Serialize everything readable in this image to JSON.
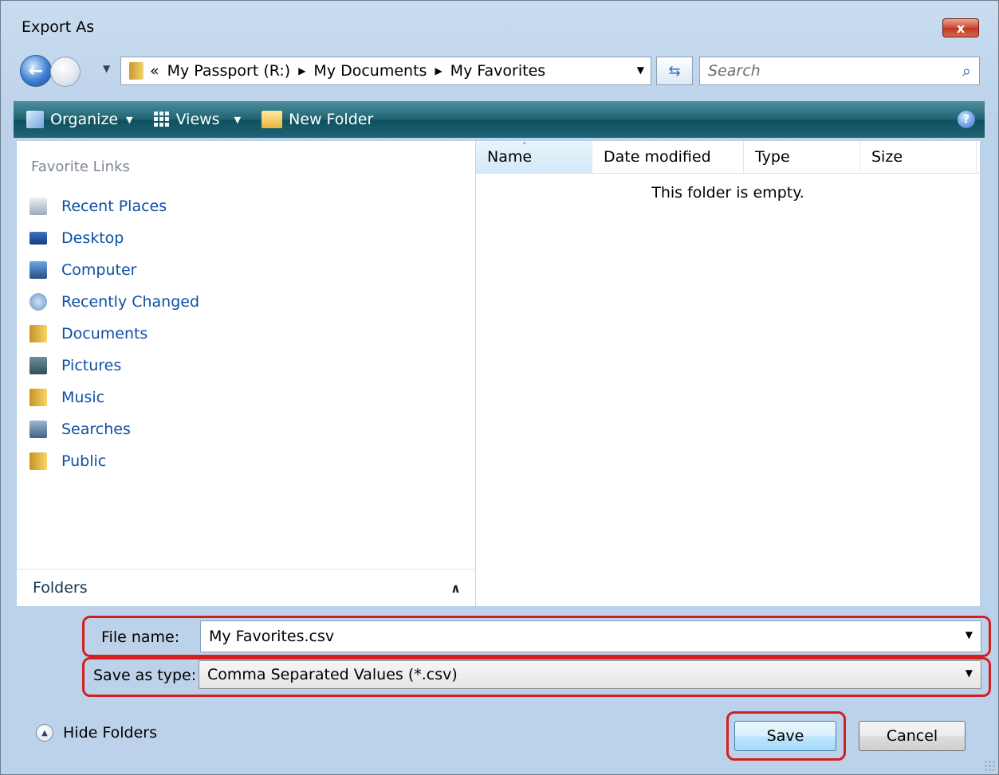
{
  "window": {
    "title": "Export As",
    "close_label": "x"
  },
  "address_bar": {
    "breadcrumbs": [
      "«",
      "My Passport (R:)",
      "My Documents",
      "My Favorites"
    ],
    "search_placeholder": "Search"
  },
  "toolbar": {
    "organize_label": "Organize",
    "views_label": "Views",
    "new_folder_label": "New Folder",
    "help_label": "?"
  },
  "nav_pane": {
    "heading": "Favorite Links",
    "items": [
      {
        "label": "Recent Places",
        "icon": "recent-places-icon"
      },
      {
        "label": "Desktop",
        "icon": "desktop-icon"
      },
      {
        "label": "Computer",
        "icon": "computer-icon"
      },
      {
        "label": "Recently Changed",
        "icon": "recently-changed-icon"
      },
      {
        "label": "Documents",
        "icon": "folder-icon"
      },
      {
        "label": "Pictures",
        "icon": "pictures-icon"
      },
      {
        "label": "Music",
        "icon": "folder-icon"
      },
      {
        "label": "Searches",
        "icon": "searches-icon"
      },
      {
        "label": "Public",
        "icon": "folder-icon"
      }
    ],
    "folders_label": "Folders"
  },
  "file_list": {
    "columns": [
      "Name",
      "Date modified",
      "Type",
      "Size"
    ],
    "empty_message": "This folder is empty."
  },
  "form": {
    "file_name_label": "File name:",
    "file_name_value": "My Favorites.csv",
    "save_type_label": "Save as type:",
    "save_type_value": "Comma Separated Values (*.csv)"
  },
  "footer": {
    "hide_folders_label": "Hide Folders",
    "save_label": "Save",
    "cancel_label": "Cancel"
  },
  "colors": {
    "highlight": "#d22020",
    "toolbar": "#1f6472",
    "link": "#0f4fa5"
  }
}
